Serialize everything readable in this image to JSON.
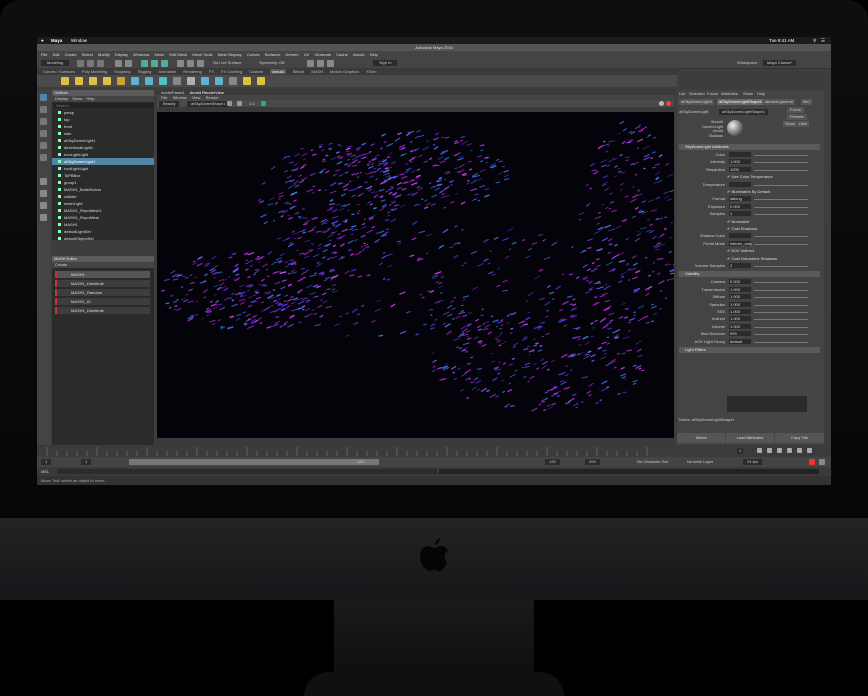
{
  "mac_menu": {
    "app": "Maya",
    "window": "Window",
    "clock": "Tue 8:41 AM"
  },
  "window_title": "Autodesk Maya 2016",
  "menus": [
    "File",
    "Edit",
    "Create",
    "Select",
    "Modify",
    "Display",
    "Windows",
    "Mesh",
    "Edit Mesh",
    "Mesh Tools",
    "Mesh Display",
    "Curves",
    "Surfaces",
    "Deform",
    "UV",
    "Generate",
    "Cache",
    "Arnold",
    "Help"
  ],
  "status": {
    "mode": "Modeling",
    "live_surface": "No Live Surface",
    "symmetry": "Symmetry: Off",
    "sign_in": "Sign In",
    "workspace_label": "Workspace :",
    "workspace": "Maya Classic*"
  },
  "shelf_tabs": [
    "Curves / Surfaces",
    "Poly Modeling",
    "Sculpting",
    "Rigging",
    "Animation",
    "Rendering",
    "FX",
    "FX Caching",
    "Custom",
    "Arnold",
    "Bifrost",
    "MASH",
    "Motion Graphics",
    "XGen"
  ],
  "shelf_active": "Arnold",
  "outliner": {
    "title": "Outliner",
    "menus": [
      "Display",
      "Show",
      "Help"
    ],
    "search_placeholder": "Search...",
    "items": [
      "persp",
      "top",
      "front",
      "side",
      "aiSkyDomeLight1",
      "directionalLight1",
      "nonLightLight",
      "aiSkyDomeLight1",
      "rootLightLight",
      "ToPBBox",
      "group1",
      "MASH1_BulletSolver",
      "collider",
      "meshLight",
      "MASH1_RepoMesh1",
      "MASH1_RepoMesh",
      "MASH1",
      "defaultLightSet",
      "defaultObjectSet"
    ],
    "selected_index": 7
  },
  "mash": {
    "title": "MASH Editor",
    "menu": "Create",
    "rows": [
      "MASH1",
      "MASH1_Distribute",
      "MASH1_Random",
      "MASH1_ID",
      "MASH1_Distribute"
    ]
  },
  "viewport": {
    "tabs": [
      "modelPanel4",
      "Arnold RenderView"
    ],
    "menus": [
      "File",
      "Window",
      "View",
      "Render"
    ],
    "camera": "Beauty",
    "shape": "aiSkyDomeShape1",
    "ratio": "1:1"
  },
  "attr": {
    "menus": [
      "List",
      "Selected",
      "Focus",
      "Attributes",
      "Show",
      "Help"
    ],
    "tabs": [
      "aiSkyDomeLight1",
      "aiSkyDomeLightShape1",
      "lambert.gamma",
      "file1"
    ],
    "node_label": "aiSkyDomeLight:",
    "node_value": "aiSkyDomeLightShape1",
    "focus": "Focus",
    "presets": "Presets",
    "show": "Show",
    "hide": "Hide",
    "swatch_caption": "Smooth Camera Light Arnold Shadows",
    "section1": "SkyDomeLight Attributes",
    "section2": "Visibility",
    "section3": "Light Filters",
    "rows1": [
      {
        "label": "Color",
        "value": ""
      },
      {
        "label": "Intensity",
        "value": "1.000"
      },
      {
        "label": "Resolution",
        "value": "1000"
      },
      {
        "label": "",
        "value": "Use Color Temperature"
      },
      {
        "label": "Temperature",
        "value": ""
      },
      {
        "label": "",
        "value": "Illuminates By Default"
      },
      {
        "label": "Format",
        "value": "latlong"
      },
      {
        "label": "Exposure",
        "value": "0.000"
      },
      {
        "label": "Samples",
        "value": "1"
      },
      {
        "label": "",
        "value": "Normalize"
      },
      {
        "label": "",
        "value": "Cast Shadows"
      },
      {
        "label": "Shadow Color",
        "value": ""
      },
      {
        "label": "Portal Mode",
        "value": "interior_only"
      },
      {
        "label": "",
        "value": "AOV Indirect"
      },
      {
        "label": "",
        "value": "Cast Volumetric Shadows"
      },
      {
        "label": "Volume Samples",
        "value": "2"
      }
    ],
    "rows2": [
      {
        "label": "Camera",
        "value": "0.000"
      },
      {
        "label": "Transmission",
        "value": "1.000"
      },
      {
        "label": "Diffuse",
        "value": "1.000"
      },
      {
        "label": "Specular",
        "value": "1.000"
      },
      {
        "label": "SSS",
        "value": "1.000"
      },
      {
        "label": "Indirect",
        "value": "1.000"
      },
      {
        "label": "Volume",
        "value": "1.000"
      },
      {
        "label": "Max Bounces",
        "value": "999"
      },
      {
        "label": "AOV Light Group",
        "value": "default"
      }
    ],
    "notes": "Notes: aiSkyDomeLightShape1",
    "buttons": [
      "Select",
      "Load Attributes",
      "Copy Tab"
    ]
  },
  "timeline": {
    "start": "1",
    "current": "1",
    "range_start": "1",
    "range_mid": "120",
    "range_end": "120",
    "end": "200",
    "character_set": "No Character Set",
    "anim_layer": "No Anim Layer",
    "fps": "24 fps"
  },
  "cmd": {
    "label": "MEL",
    "help": "Move Tool: select an object to move."
  },
  "accent": {
    "selection": "#5285a6",
    "mash_bar": "#cc3333",
    "render_magenta": "#c020e0",
    "render_violet": "#6a30ff"
  }
}
